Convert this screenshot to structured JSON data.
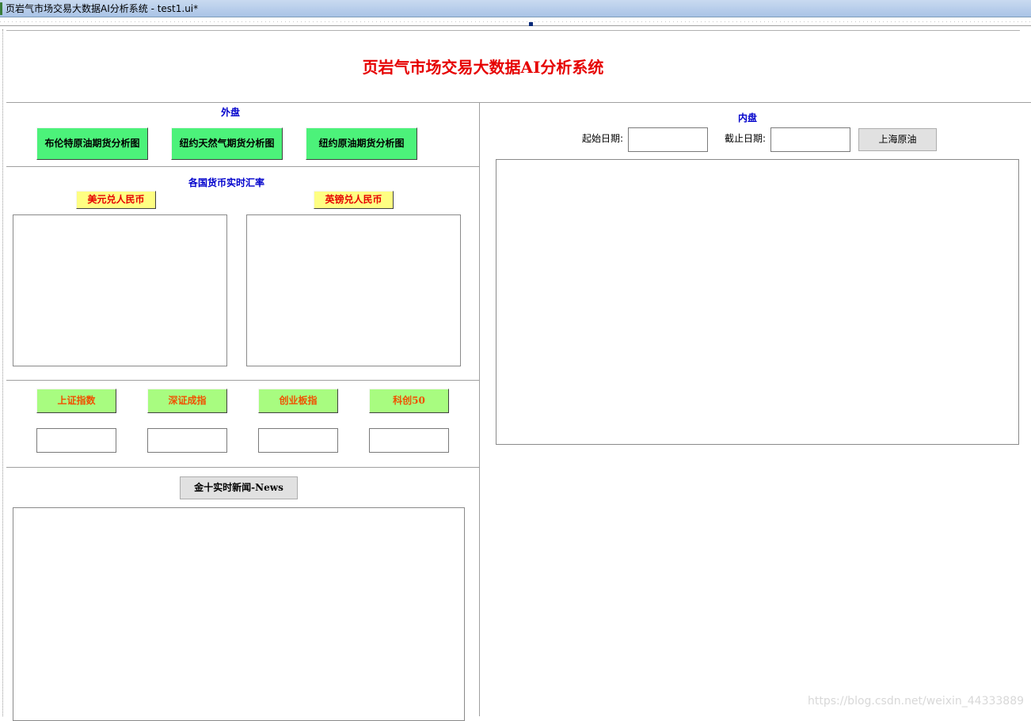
{
  "window": {
    "title": "页岩气市场交易大数据AI分析系统 - test1.ui*"
  },
  "header": {
    "title": "页岩气市场交易大数据AI分析系统"
  },
  "outer_market": {
    "label": "外盘",
    "buttons": [
      "布伦特原油期货分析图",
      "纽约天然气期货分析图",
      "纽约原油期货分析图"
    ]
  },
  "fx": {
    "label": "各国货币实时汇率",
    "usd_cny": "美元兑人民币",
    "gbp_cny": "英镑兑人民币"
  },
  "indices": {
    "buttons": [
      "上证指数",
      "深证成指",
      "创业板指",
      "科创50"
    ],
    "values": [
      "",
      "",
      "",
      ""
    ]
  },
  "news": {
    "button": "金十实时新闻-News"
  },
  "inner_market": {
    "label": "内盘",
    "start_date_label": "起始日期:",
    "end_date_label": "截止日期:",
    "start_date_value": "",
    "end_date_value": "",
    "shanghai_crude_button": "上海原油"
  },
  "watermark": "https://blog.csdn.net/weixin_44333889",
  "colors": {
    "title_red": "#e60000",
    "label_blue": "#0000cc",
    "button_green": "#4cf27a",
    "button_yellow": "#fefe82",
    "button_lightgreen": "#a8fc80"
  }
}
